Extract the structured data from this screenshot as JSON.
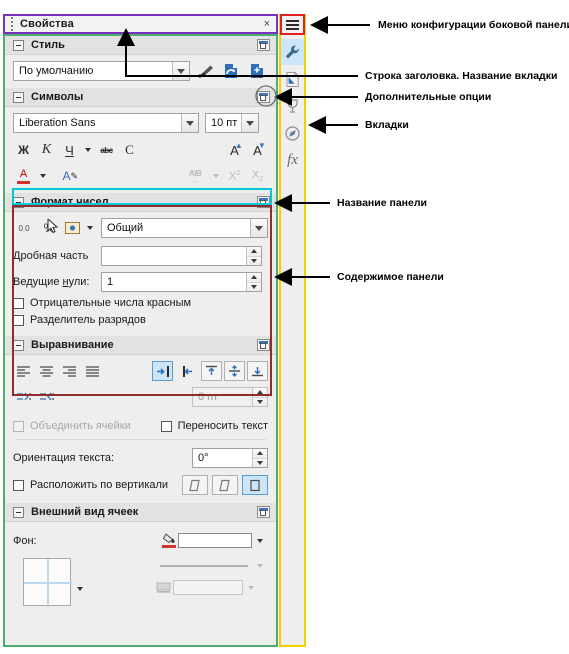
{
  "deck": {
    "title": "Свойства",
    "close_label": "×"
  },
  "panels": [
    {
      "title": "Стиль",
      "style_combo_value": "По умолчанию",
      "buttons": [
        "clone-formatting",
        "update-style",
        "new-style"
      ]
    },
    {
      "title": "Символы",
      "font_name": "Liberation Sans",
      "font_size": "10 пт",
      "glyphs": {
        "bold": "Ж",
        "italic": "K",
        "underline": "Ч",
        "strikethrough": "abc",
        "overline": "C",
        "grow": "A",
        "shrink": "A",
        "spacing": "A\\B",
        "superscript": "X",
        "superscript_sup": "2",
        "subscript": "X",
        "subscript_sub": "2",
        "font_color": "A",
        "highlight": "A"
      }
    },
    {
      "title": "Формат чисел",
      "format_value": "Общий",
      "decimal_label": "Дробная часть",
      "decimal_value": "",
      "leading_zeros_label": "Ведущие нули:",
      "leading_zeros_value": "1",
      "negative_red_label": "Отрицательные числа красным",
      "thousands_sep_label": "Разделитель разрядов",
      "toolbar_glyph": "0.0"
    },
    {
      "title": "Выравнивание",
      "indent_value": "0 пт",
      "merge_cells_label": "Объединить ячейки",
      "wrap_text_label": "Переносить текст",
      "orientation_label": "Ориентация текста:",
      "orientation_value": "0°",
      "vertical_stack_label": "Расположить по вертикали"
    },
    {
      "title": "Внешний вид ячеек",
      "background_label": "Фон:"
    }
  ],
  "tabs": [
    {
      "name": "sidebar-settings",
      "icon": "hamburger-icon"
    },
    {
      "name": "properties",
      "icon": "wrench-icon",
      "active": true
    },
    {
      "name": "styles",
      "icon": "styles-icon",
      "active": false
    },
    {
      "name": "gallery",
      "icon": "gallery-icon",
      "active": false
    },
    {
      "name": "navigator",
      "icon": "navigator-icon",
      "active": false
    },
    {
      "name": "functions",
      "icon": "functions-icon",
      "active": false
    }
  ],
  "annotations": [
    {
      "id": "a1",
      "text": "Меню конфигурации боковой панели"
    },
    {
      "id": "a2",
      "text": "Строка заголовка. Название вкладки"
    },
    {
      "id": "a3",
      "text": "Дополнительные опции"
    },
    {
      "id": "a4",
      "text": "Вкладки"
    },
    {
      "id": "a5",
      "text": "Название панели"
    },
    {
      "id": "a6",
      "text": "Содержимое панели"
    }
  ],
  "colors": {
    "titlebar_outline": "#7b2fbe",
    "deck_outline": "#4caf70",
    "tabbar_outline": "#f5d000",
    "menu_outline": "#e02020",
    "panel_title_outline": "#00c8d7",
    "panel_body_outline": "#8d2d2d",
    "accent": "#3a76c0"
  }
}
